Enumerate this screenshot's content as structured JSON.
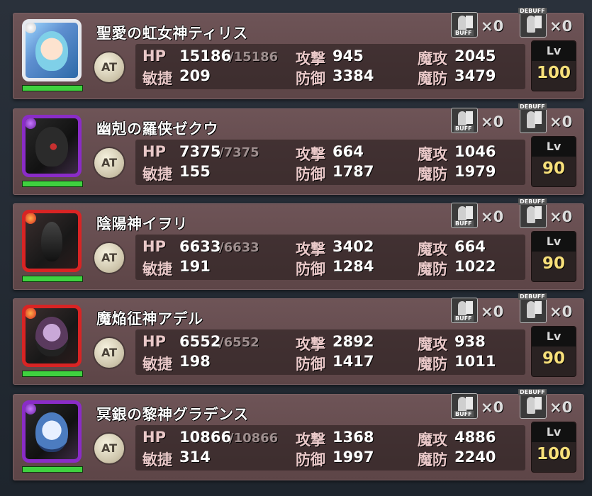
{
  "labels": {
    "hp": "HP",
    "atk": "攻撃",
    "matk": "魔攻",
    "agi": "敏捷",
    "def": "防御",
    "mdef": "魔防",
    "at": "AT",
    "lv": "Lv",
    "buff": "BUFF",
    "debuff": "DEBUFF"
  },
  "characters": [
    {
      "name": "聖愛の虹女神ティリス",
      "hp": "15186",
      "hp_max": "/15186",
      "atk": "945",
      "matk": "2045",
      "agi": "209",
      "def": "3384",
      "mdef": "3479",
      "level": "100",
      "buff_count": "×0",
      "debuff_count": "×0",
      "hp_fraction": 1.0
    },
    {
      "name": "幽剋の羅侠ゼクウ",
      "hp": "7375",
      "hp_max": "/7375",
      "atk": "664",
      "matk": "1046",
      "agi": "155",
      "def": "1787",
      "mdef": "1979",
      "level": "90",
      "buff_count": "×0",
      "debuff_count": "×0",
      "hp_fraction": 1.0
    },
    {
      "name": "陰陽神イヲリ",
      "hp": "6633",
      "hp_max": "/6633",
      "atk": "3402",
      "matk": "664",
      "agi": "191",
      "def": "1284",
      "mdef": "1022",
      "level": "90",
      "buff_count": "×0",
      "debuff_count": "×0",
      "hp_fraction": 1.0
    },
    {
      "name": "魔焔征神アデル",
      "hp": "6552",
      "hp_max": "/6552",
      "atk": "2892",
      "matk": "938",
      "agi": "198",
      "def": "1417",
      "mdef": "1011",
      "level": "90",
      "buff_count": "×0",
      "debuff_count": "×0",
      "hp_fraction": 1.0
    },
    {
      "name": "冥銀の黎神グラデンス",
      "hp": "10866",
      "hp_max": "/10866",
      "atk": "1368",
      "matk": "4886",
      "agi": "314",
      "def": "1997",
      "mdef": "2240",
      "level": "100",
      "buff_count": "×0",
      "debuff_count": "×0",
      "hp_fraction": 1.0
    }
  ],
  "colors": {
    "panel": "#6e5457",
    "level_text": "#f7e07a",
    "hp_bar": "#3fd23f",
    "frame_rainbow": "#e6e9ee",
    "frame_dark": "#8a2cc7",
    "frame_fire": "#d82424"
  }
}
